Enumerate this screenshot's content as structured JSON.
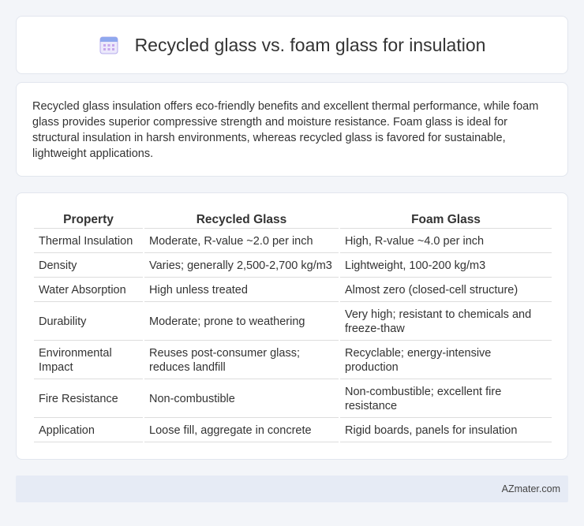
{
  "header": {
    "title": "Recycled glass vs. foam glass for insulation",
    "icon": "calendar-icon"
  },
  "summary": {
    "text": "Recycled glass insulation offers eco-friendly benefits and excellent thermal performance, while foam glass provides superior compressive strength and moisture resistance. Foam glass is ideal for structural insulation in harsh environments, whereas recycled glass is favored for sustainable, lightweight applications."
  },
  "table": {
    "headers": [
      "Property",
      "Recycled Glass",
      "Foam Glass"
    ],
    "rows": [
      [
        "Thermal Insulation",
        "Moderate, R-value ~2.0 per inch",
        "High, R-value ~4.0 per inch"
      ],
      [
        "Density",
        "Varies; generally 2,500-2,700 kg/m3",
        "Lightweight, 100-200 kg/m3"
      ],
      [
        "Water Absorption",
        "High unless treated",
        "Almost zero (closed-cell structure)"
      ],
      [
        "Durability",
        "Moderate; prone to weathering",
        "Very high; resistant to chemicals and freeze-thaw"
      ],
      [
        "Environmental Impact",
        "Reuses post-consumer glass; reduces landfill",
        "Recyclable; energy-intensive production"
      ],
      [
        "Fire Resistance",
        "Non-combustible",
        "Non-combustible; excellent fire resistance"
      ],
      [
        "Application",
        "Loose fill, aggregate in concrete",
        "Rigid boards, panels for insulation"
      ]
    ]
  },
  "footer": {
    "text": "AZmater.com"
  },
  "colors": {
    "background": "#f3f5f9",
    "card": "#ffffff",
    "footer_bg": "#e6ebf5",
    "icon_accent": "#8b7fd9"
  }
}
